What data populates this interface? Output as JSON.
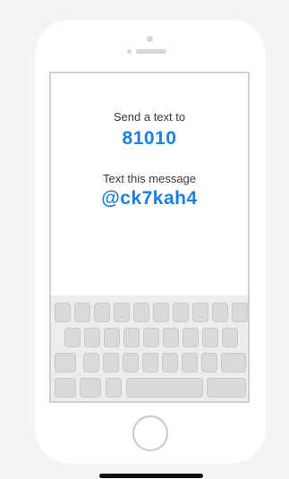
{
  "instructions": {
    "send_label": "Send a text to",
    "number": "81010",
    "message_label": "Text this message",
    "message": "@ck7kah4"
  },
  "colors": {
    "accent": "#1b7fe0",
    "phone_body": "#ffffff",
    "screen_border": "#cfcfcf",
    "keyboard_bg": "#ececec",
    "key": "#d9d9d9"
  },
  "icons": {
    "speaker": "speaker-slot",
    "camera": "camera-dot",
    "home": "home-button-ring"
  }
}
